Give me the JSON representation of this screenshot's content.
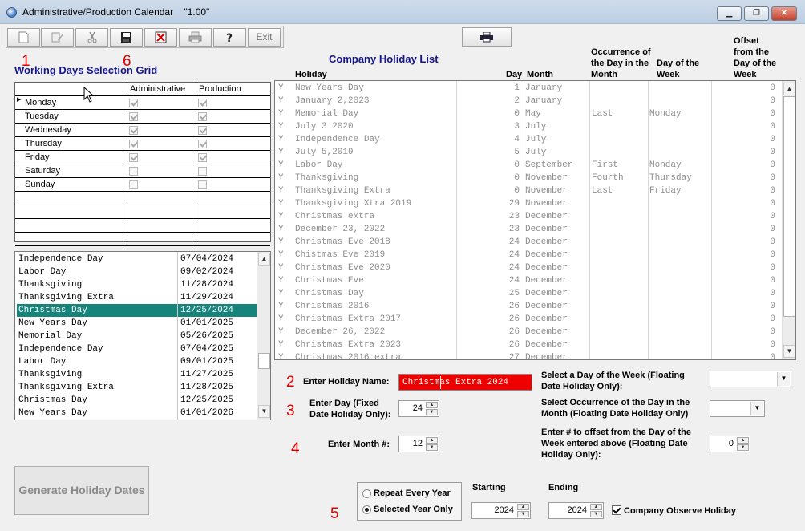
{
  "window": {
    "title": "Administrative/Production Calendar    \"1.00\""
  },
  "toolbar": {
    "exit_label": "Exit"
  },
  "annotations": [
    "1",
    "6",
    "2",
    "3",
    "4",
    "5"
  ],
  "working_days": {
    "title": "Working Days Selection Grid",
    "col_admin": "Administrative",
    "col_prod": "Production",
    "rows": [
      {
        "day": "Monday",
        "admin": true,
        "prod": true
      },
      {
        "day": "Tuesday",
        "admin": true,
        "prod": true
      },
      {
        "day": "Wednesday",
        "admin": true,
        "prod": true
      },
      {
        "day": "Thursday",
        "admin": true,
        "prod": true
      },
      {
        "day": "Friday",
        "admin": true,
        "prod": true
      },
      {
        "day": "Saturday",
        "admin": false,
        "prod": false
      },
      {
        "day": "Sunday",
        "admin": false,
        "prod": false
      }
    ]
  },
  "dates_list": {
    "selected_index": 4,
    "rows": [
      {
        "name": "Independence Day",
        "date": "07/04/2024"
      },
      {
        "name": "Labor Day",
        "date": "09/02/2024"
      },
      {
        "name": "Thanksgiving",
        "date": "11/28/2024"
      },
      {
        "name": "Thanksgiving Extra",
        "date": "11/29/2024"
      },
      {
        "name": "Christmas Day",
        "date": "12/25/2024"
      },
      {
        "name": "New Years Day",
        "date": "01/01/2025"
      },
      {
        "name": "Memorial Day",
        "date": "05/26/2025"
      },
      {
        "name": "Independence Day",
        "date": "07/04/2025"
      },
      {
        "name": "Labor Day",
        "date": "09/01/2025"
      },
      {
        "name": "Thanksgiving",
        "date": "11/27/2025"
      },
      {
        "name": "Thanksgiving Extra",
        "date": "11/28/2025"
      },
      {
        "name": "Christmas Day",
        "date": "12/25/2025"
      },
      {
        "name": "New Years Day",
        "date": "01/01/2026"
      }
    ]
  },
  "holiday_list": {
    "title": "Company Holiday List",
    "headers": {
      "holiday": "Holiday",
      "day": "Day",
      "month": "Month",
      "occurrence": [
        "Occurrence of",
        "the Day in the",
        "Month"
      ],
      "dow": [
        "Day of  the",
        "Week"
      ],
      "offset": [
        "Offset",
        "from the",
        "Day of  the",
        "Week"
      ]
    },
    "rows": [
      {
        "flag": "Y",
        "name": "New Years Day",
        "day": "1",
        "month": "January",
        "occ": "",
        "dow": "",
        "offset": "0"
      },
      {
        "flag": "Y",
        "name": "January 2,2023",
        "day": "2",
        "month": "January",
        "occ": "",
        "dow": "",
        "offset": "0"
      },
      {
        "flag": "Y",
        "name": "Memorial Day",
        "day": "0",
        "month": "May",
        "occ": "Last",
        "dow": "Monday",
        "offset": "0"
      },
      {
        "flag": "Y",
        "name": "July 3 2020",
        "day": "3",
        "month": "July",
        "occ": "",
        "dow": "",
        "offset": "0"
      },
      {
        "flag": "Y",
        "name": "Independence Day",
        "day": "4",
        "month": "July",
        "occ": "",
        "dow": "",
        "offset": "0"
      },
      {
        "flag": "Y",
        "name": "July 5,2019",
        "day": "5",
        "month": "July",
        "occ": "",
        "dow": "",
        "offset": "0"
      },
      {
        "flag": "Y",
        "name": "Labor Day",
        "day": "0",
        "month": "September",
        "occ": "First",
        "dow": "Monday",
        "offset": "0"
      },
      {
        "flag": "Y",
        "name": "Thanksgiving",
        "day": "0",
        "month": "November",
        "occ": "Fourth",
        "dow": "Thursday",
        "offset": "0"
      },
      {
        "flag": "Y",
        "name": "Thanksgiving Extra",
        "day": "0",
        "month": "November",
        "occ": "Last",
        "dow": "Friday",
        "offset": "0"
      },
      {
        "flag": "Y",
        "name": "Thanksgiving Xtra 2019",
        "day": "29",
        "month": "November",
        "occ": "",
        "dow": "",
        "offset": "0"
      },
      {
        "flag": "Y",
        "name": "Christmas extra",
        "day": "23",
        "month": "December",
        "occ": "",
        "dow": "",
        "offset": "0"
      },
      {
        "flag": "Y",
        "name": "December 23, 2022",
        "day": "23",
        "month": "December",
        "occ": "",
        "dow": "",
        "offset": "0"
      },
      {
        "flag": "Y",
        "name": "Christmas Eve 2018",
        "day": "24",
        "month": "December",
        "occ": "",
        "dow": "",
        "offset": "0"
      },
      {
        "flag": "Y",
        "name": "Chistmas Eve 2019",
        "day": "24",
        "month": "December",
        "occ": "",
        "dow": "",
        "offset": "0"
      },
      {
        "flag": "Y",
        "name": "Christmas Eve 2020",
        "day": "24",
        "month": "December",
        "occ": "",
        "dow": "",
        "offset": "0"
      },
      {
        "flag": "Y",
        "name": "Christmas Eve",
        "day": "24",
        "month": "December",
        "occ": "",
        "dow": "",
        "offset": "0"
      },
      {
        "flag": "Y",
        "name": "Christmas Day",
        "day": "25",
        "month": "December",
        "occ": "",
        "dow": "",
        "offset": "0"
      },
      {
        "flag": "Y",
        "name": "Christmas 2016",
        "day": "26",
        "month": "December",
        "occ": "",
        "dow": "",
        "offset": "0"
      },
      {
        "flag": "Y",
        "name": "Christmas Extra 2017",
        "day": "26",
        "month": "December",
        "occ": "",
        "dow": "",
        "offset": "0"
      },
      {
        "flag": "Y",
        "name": "December 26, 2022",
        "day": "26",
        "month": "December",
        "occ": "",
        "dow": "",
        "offset": "0"
      },
      {
        "flag": "Y",
        "name": "Christmas Extra 2023",
        "day": "26",
        "month": "December",
        "occ": "",
        "dow": "",
        "offset": "0"
      },
      {
        "flag": "Y",
        "name": "Christmas 2016 extra",
        "day": "27",
        "month": "December",
        "occ": "",
        "dow": "",
        "offset": "0"
      }
    ]
  },
  "form": {
    "holiday_name_label": "Enter Holiday Name:",
    "holiday_name_value": "Christmas Extra 2024",
    "day_label": "Enter Day (Fixed Date Holiday Only):",
    "day_value": "24",
    "month_label": "Enter Month #:",
    "month_value": "12",
    "dow_label": "Select a Day of the Week  (Floating Date Holiday Only):",
    "dow_value": "",
    "occurrence_label": "Select Occurrence of the Day in the Month  (Floating Date Holiday Only)",
    "occurrence_value": "",
    "offset_label": "Enter # to offset from the Day of the Week entered above  (Floating Date Holiday Only):",
    "offset_value": "0",
    "generate_label": "Generate Holiday Dates",
    "repeat_label": "Repeat Every Year",
    "selected_year_label": "Selected Year Only",
    "starting_label": "Starting",
    "ending_label": "Ending",
    "starting_value": "2024",
    "ending_value": "2024",
    "observe_label": "Company Observe Holiday",
    "observe_checked": true,
    "mode": "selected"
  }
}
